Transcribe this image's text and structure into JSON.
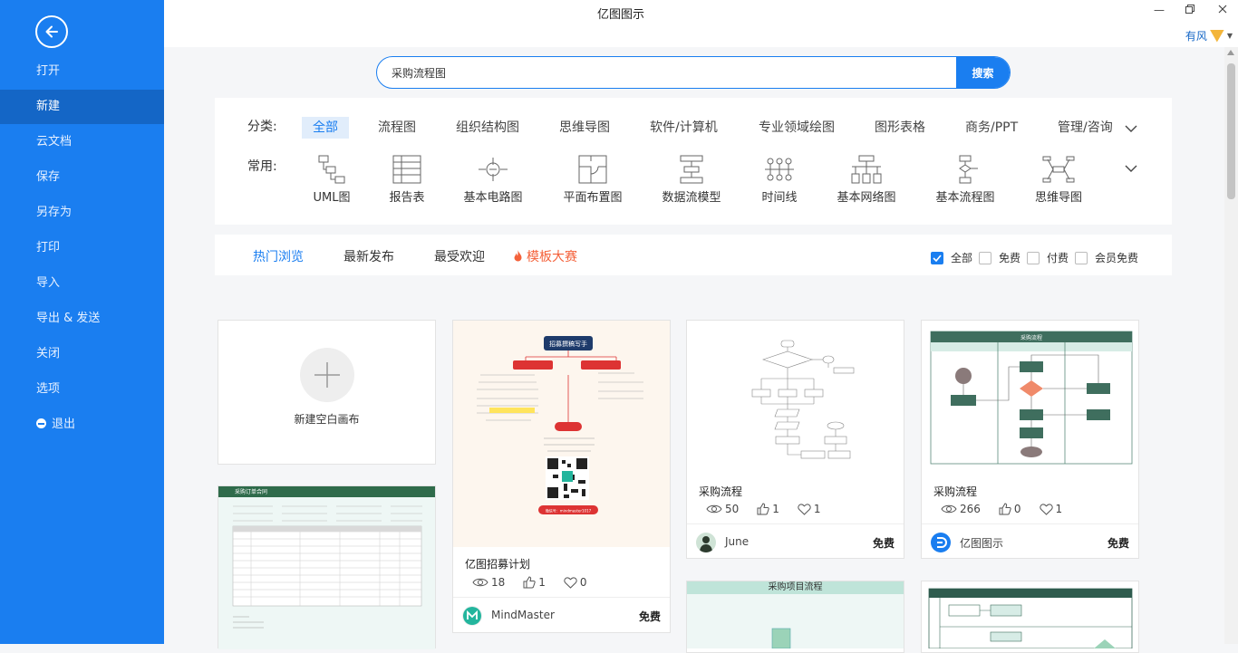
{
  "sidebar": {
    "items": [
      {
        "label": "打开"
      },
      {
        "label": "新建"
      },
      {
        "label": "云文档"
      },
      {
        "label": "保存"
      },
      {
        "label": "另存为"
      },
      {
        "label": "打印"
      },
      {
        "label": "导入"
      },
      {
        "label": "导出 & 发送"
      },
      {
        "label": "关闭"
      },
      {
        "label": "选项"
      },
      {
        "label": "退出"
      }
    ],
    "active_index": 1
  },
  "window": {
    "title": "亿图图示",
    "user": "有风"
  },
  "search": {
    "value": "采购流程图",
    "button": "搜索"
  },
  "categories": {
    "label": "分类:",
    "items": [
      "全部",
      "流程图",
      "组织结构图",
      "思维导图",
      "软件/计算机",
      "专业领域绘图",
      "图形表格",
      "商务/PPT",
      "管理/咨询"
    ],
    "active_index": 0
  },
  "common": {
    "label": "常用:",
    "items": [
      "UML图",
      "报告表",
      "基本电路图",
      "平面布置图",
      "数据流模型",
      "时间线",
      "基本网络图",
      "基本流程图",
      "思维导图"
    ]
  },
  "tabs": {
    "items": [
      "热门浏览",
      "最新发布",
      "最受欢迎",
      "模板大赛"
    ],
    "active_index": 0
  },
  "filters": [
    {
      "label": "全部",
      "checked": true
    },
    {
      "label": "免费",
      "checked": false
    },
    {
      "label": "付费",
      "checked": false
    },
    {
      "label": "会员免费",
      "checked": false
    }
  ],
  "cards": {
    "blank": {
      "label": "新建空白画布"
    },
    "c1": {
      "title": "亿图招募计划",
      "views": "18",
      "likes": "1",
      "favs": "0",
      "author": "MindMaster",
      "price": "免费",
      "thumb_heading": "招募撰稿写手",
      "thumb_footer": "微信号：mindmaster1017"
    },
    "c2": {
      "title": "采购流程",
      "views": "50",
      "likes": "1",
      "favs": "1",
      "author": "June",
      "price": "免费"
    },
    "c3": {
      "title": "采购流程",
      "views": "266",
      "likes": "0",
      "favs": "1",
      "author": "亿图图示",
      "price": "免费",
      "thumb_heading": "采购流程"
    },
    "c4": {
      "thumb_heading": "采购订单合同"
    },
    "c5": {
      "thumb_heading": "采购项目流程"
    }
  }
}
